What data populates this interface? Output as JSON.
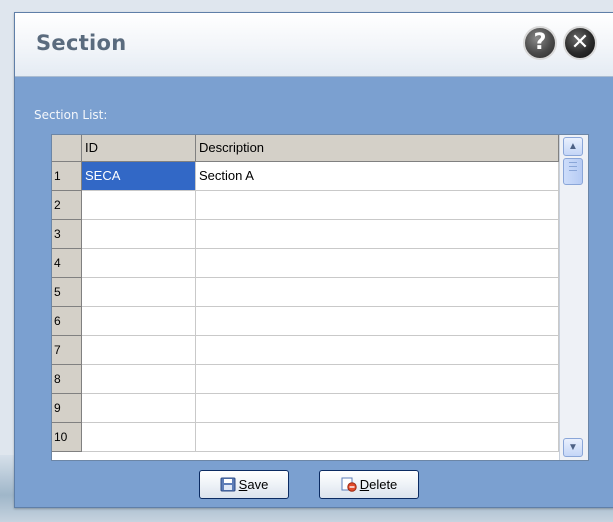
{
  "dialog": {
    "title": "Section",
    "help_icon": "?",
    "close_icon": "✕"
  },
  "section_list": {
    "label": "Section List:",
    "columns": [
      "ID",
      "Description"
    ],
    "row_numbers": [
      "1",
      "2",
      "3",
      "4",
      "5",
      "6",
      "7",
      "8",
      "9",
      "10"
    ],
    "rows": [
      {
        "id": "SECA",
        "description": "Section A"
      },
      {
        "id": "",
        "description": ""
      },
      {
        "id": "",
        "description": ""
      },
      {
        "id": "",
        "description": ""
      },
      {
        "id": "",
        "description": ""
      },
      {
        "id": "",
        "description": ""
      },
      {
        "id": "",
        "description": ""
      },
      {
        "id": "",
        "description": ""
      },
      {
        "id": "",
        "description": ""
      },
      {
        "id": "",
        "description": ""
      }
    ],
    "selected_cell": "SECA"
  },
  "buttons": {
    "save_label": "Save",
    "save_mnemonic": "S",
    "save_rest": "ave",
    "delete_label": "Delete",
    "delete_mnemonic": "D",
    "delete_rest": "elete"
  },
  "icons": {
    "help": "question-circle-icon",
    "close": "close-circle-icon",
    "save": "floppy-disk-icon",
    "delete": "delete-document-icon",
    "scroll_up": "chevron-up-icon",
    "scroll_down": "chevron-down-icon"
  },
  "colors": {
    "dialog_bg": "#7ba0d0",
    "selected_cell": "#3268c6",
    "header_bg": "#d4d0c8"
  }
}
